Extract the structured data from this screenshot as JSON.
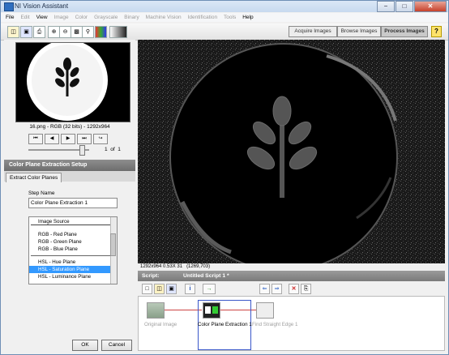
{
  "window": {
    "title": "NI Vision Assistant",
    "buttons": [
      "−",
      "□",
      "✕"
    ]
  },
  "menu": [
    {
      "label": "File",
      "enabled": true
    },
    {
      "label": "Edit",
      "enabled": false
    },
    {
      "label": "View",
      "enabled": true
    },
    {
      "label": "Image",
      "enabled": false
    },
    {
      "label": "Color",
      "enabled": false
    },
    {
      "label": "Grayscale",
      "enabled": false
    },
    {
      "label": "Binary",
      "enabled": false
    },
    {
      "label": "Machine Vision",
      "enabled": false
    },
    {
      "label": "Identification",
      "enabled": false
    },
    {
      "label": "Tools",
      "enabled": false
    },
    {
      "label": "Help",
      "enabled": true
    }
  ],
  "toolbar": {
    "icons": [
      "open-image-icon",
      "save-icon",
      "print-icon",
      "zoom-in-icon",
      "zoom-out-icon",
      "zoom-fit-icon",
      "zoom-1-1-icon",
      "color-palette-icon",
      "gradient-icon"
    ],
    "tabs": [
      {
        "label": "Acquire Images",
        "active": false
      },
      {
        "label": "Browse Images",
        "active": false
      },
      {
        "label": "Process Images",
        "active": true
      }
    ],
    "help": "?"
  },
  "browser": {
    "caption": "16.png - RGB (32 bits) - 1292x964",
    "nav": [
      "⏮",
      "◀",
      "▶",
      "⏭",
      "↪"
    ],
    "page_current": "1",
    "page_of": "of",
    "page_total": "1"
  },
  "setup": {
    "title": "Color Plane Extraction Setup",
    "tab": "Extract Color Planes",
    "step_name_label": "Step Name",
    "step_name_value": "Color Plane Extraction 1",
    "list_header": "Image Source",
    "list_items": [
      {
        "label": "RGB - Red Plane",
        "selected": false
      },
      {
        "label": "RGB - Green Plane",
        "selected": false
      },
      {
        "label": "RGB - Blue Plane",
        "selected": false
      },
      {
        "label": "HSL - Hue Plane",
        "selected": false
      },
      {
        "label": "HSL - Saturation Plane",
        "selected": true
      },
      {
        "label": "HSL - Luminance Plane",
        "selected": false
      }
    ],
    "ok": "OK",
    "cancel": "Cancel"
  },
  "status": {
    "image_info": "1292x964 0.53X 31",
    "coords": "(1269,703)"
  },
  "script": {
    "label": "Script:",
    "name": "Untitled Script 1 *",
    "steps": [
      {
        "label": "Original Image",
        "active": false
      },
      {
        "label": "Color Plane Extraction 1",
        "active": true
      },
      {
        "label": "Find Straight Edge 1",
        "active": false
      }
    ]
  }
}
